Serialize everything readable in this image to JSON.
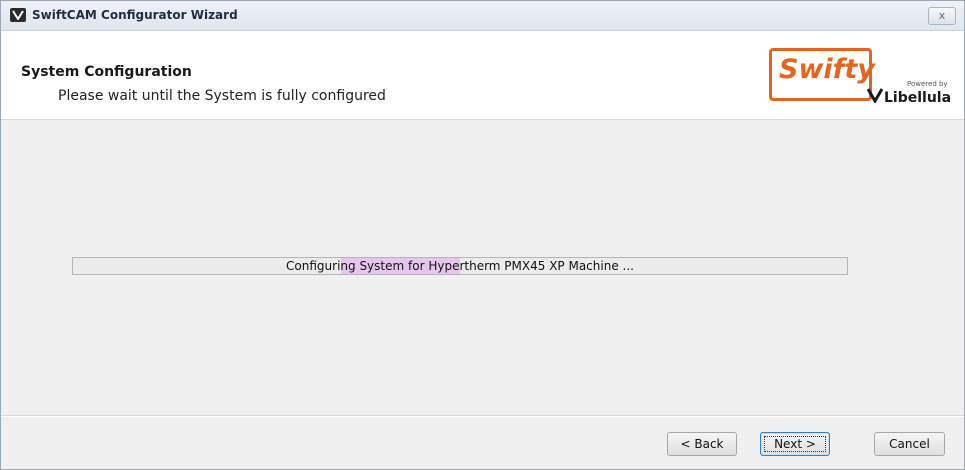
{
  "window": {
    "title": "SwiftCAM Configurator Wizard",
    "close_label": "x"
  },
  "header": {
    "title": "System Configuration",
    "subtitle": "Please wait until the System is fully configured"
  },
  "branding": {
    "logo_text": "Swifty",
    "powered_by": "Powered by",
    "vendor": "Libellula",
    "accent": "#e2661f"
  },
  "progress": {
    "status_text": "Configuring System for Hypertherm PMX45 XP Machine ...",
    "fill_fraction": 0.0
  },
  "buttons": {
    "back_label": "< Back",
    "next_label": "Next >",
    "cancel_label": "Cancel"
  }
}
